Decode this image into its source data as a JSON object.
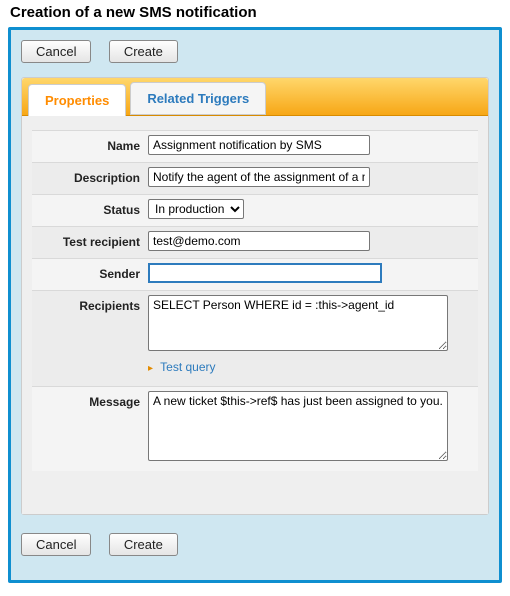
{
  "page": {
    "title": "Creation of a new SMS notification"
  },
  "buttons": {
    "cancel": "Cancel",
    "create": "Create"
  },
  "tabs": {
    "properties": "Properties",
    "related_triggers": "Related Triggers"
  },
  "labels": {
    "name": "Name",
    "description": "Description",
    "status": "Status",
    "test_recipient": "Test recipient",
    "sender": "Sender",
    "recipients": "Recipients",
    "message": "Message",
    "test_query": "Test query"
  },
  "fields": {
    "name": "Assignment notification by SMS",
    "description": "Notify the agent of the assignment of a new ticket",
    "status": "In production",
    "status_options": [
      "In production"
    ],
    "test_recipient": "test@demo.com",
    "sender": "",
    "recipients": "SELECT Person WHERE id = :this->agent_id",
    "message": "A new ticket $this->ref$ has just been assigned to you."
  }
}
